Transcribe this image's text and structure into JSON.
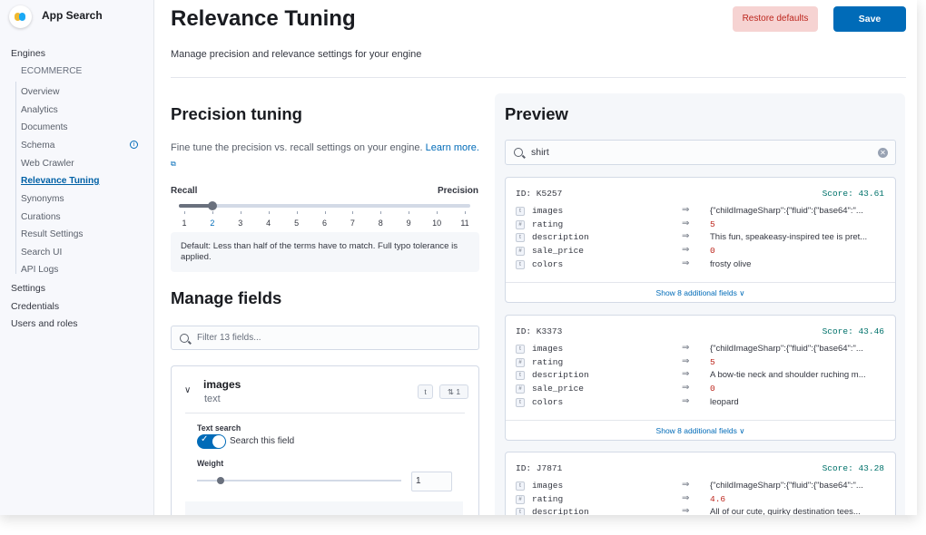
{
  "sidebar": {
    "app_title": "App Search",
    "engines_label": "Engines",
    "engine_name": "ECOMMERCE",
    "engine_items": [
      "Overview",
      "Analytics",
      "Documents",
      "Schema",
      "Web Crawler",
      "Relevance Tuning",
      "Synonyms",
      "Curations",
      "Result Settings",
      "Search UI",
      "API Logs"
    ],
    "active_item": "Relevance Tuning",
    "bottom_items": [
      "Settings",
      "Credentials",
      "Users and roles"
    ]
  },
  "header": {
    "title": "Relevance Tuning",
    "restore_label": "Restore defaults",
    "save_label": "Save",
    "subtitle": "Manage precision and relevance settings for your engine"
  },
  "precision": {
    "title": "Precision tuning",
    "description": "Fine tune the precision vs. recall settings on your engine.",
    "learn_more": "Learn more.",
    "recall_label": "Recall",
    "precision_label": "Precision",
    "ticks": [
      "1",
      "2",
      "3",
      "4",
      "5",
      "6",
      "7",
      "8",
      "9",
      "10",
      "11"
    ],
    "selected": 2,
    "hint": "Default: Less than half of the terms have to match. Full typo tolerance is applied."
  },
  "manage_fields": {
    "title": "Manage fields",
    "filter_placeholder": "Filter 13 fields...",
    "field": {
      "name": "images",
      "type": "text",
      "type_badge": "t",
      "boost_count": "1",
      "text_search_label": "Text search",
      "toggle_label": "Search this field",
      "toggle_on": true,
      "weight_label": "Weight",
      "weight_value": "1"
    }
  },
  "preview": {
    "title": "Preview",
    "search_value": "shirt",
    "results": [
      {
        "id": "ID: K5257",
        "score": "Score: 43.61",
        "fields": [
          {
            "icon": "t",
            "key": "images",
            "value": "{\"childImageSharp\":{\"fluid\":{\"base64\":\"...",
            "numeric": false
          },
          {
            "icon": "#",
            "key": "rating",
            "value": "5",
            "numeric": true
          },
          {
            "icon": "t",
            "key": "description",
            "value": "This fun, speakeasy-inspired tee is pret...",
            "numeric": false
          },
          {
            "icon": "#",
            "key": "sale_price",
            "value": "0",
            "numeric": true
          },
          {
            "icon": "t",
            "key": "colors",
            "value": "frosty olive",
            "numeric": false
          }
        ],
        "more": "Show 8 additional fields"
      },
      {
        "id": "ID: K3373",
        "score": "Score: 43.46",
        "fields": [
          {
            "icon": "t",
            "key": "images",
            "value": "{\"childImageSharp\":{\"fluid\":{\"base64\":\"...",
            "numeric": false
          },
          {
            "icon": "#",
            "key": "rating",
            "value": "5",
            "numeric": true
          },
          {
            "icon": "t",
            "key": "description",
            "value": "A bow-tie neck and shoulder ruching m...",
            "numeric": false
          },
          {
            "icon": "#",
            "key": "sale_price",
            "value": "0",
            "numeric": true
          },
          {
            "icon": "t",
            "key": "colors",
            "value": "leopard",
            "numeric": false
          }
        ],
        "more": "Show 8 additional fields"
      },
      {
        "id": "ID: J7871",
        "score": "Score: 43.28",
        "fields": [
          {
            "icon": "t",
            "key": "images",
            "value": "{\"childImageSharp\":{\"fluid\":{\"base64\":\"...",
            "numeric": false
          },
          {
            "icon": "#",
            "key": "rating",
            "value": "4.6",
            "numeric": true
          },
          {
            "icon": "t",
            "key": "description",
            "value": "All of our cute, quirky destination tees...",
            "numeric": false
          }
        ],
        "more": ""
      }
    ]
  },
  "colors": {
    "accent": "#006bb8",
    "danger": "#bd271e",
    "score": "#00726b"
  }
}
